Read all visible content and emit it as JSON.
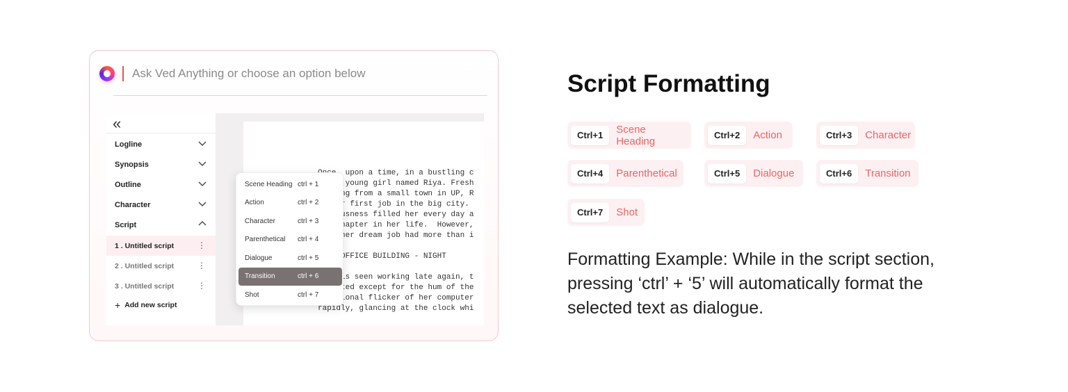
{
  "app": {
    "ask_placeholder": "Ask Ved Anything or choose an option below",
    "collapse_glyph": "«",
    "sidebar": {
      "sections": [
        {
          "label": "Logline",
          "expanded": false
        },
        {
          "label": "Synopsis",
          "expanded": false
        },
        {
          "label": "Outline",
          "expanded": false
        },
        {
          "label": "Character",
          "expanded": false
        },
        {
          "label": "Script",
          "expanded": true
        }
      ],
      "scripts": [
        {
          "label": "1 . Untitled script",
          "active": true
        },
        {
          "label": "2 . Untitled script",
          "active": false
        },
        {
          "label": "3 . Untitled script",
          "active": false
        }
      ],
      "add_script_label": "Add new script",
      "more_glyph": "⋮"
    },
    "format_menu": [
      {
        "name": "Scene Heading",
        "key": "ctrl + 1",
        "selected": false
      },
      {
        "name": "Action",
        "key": "ctrl + 2",
        "selected": false
      },
      {
        "name": "Character",
        "key": "ctrl + 3",
        "selected": false
      },
      {
        "name": "Parenthetical",
        "key": "ctrl + 4",
        "selected": false
      },
      {
        "name": "Dialogue",
        "key": "ctrl + 5",
        "selected": false
      },
      {
        "name": "Transition",
        "key": "ctrl + 6",
        "selected": true
      },
      {
        "name": "Shot",
        "key": "ctrl + 7",
        "selected": false
      }
    ],
    "script_lines": [
      "Once  upon a time, in a bustling c",
      "was a young girl named Riya. Fresh",
      "hailing from a small town in UP, R",
      "to her first job in the big city.",
      "nervousness filled her every day a",
      "new chapter in her life.  However,",
      "that her dream job had more than i",
      "",
      "INT. OFFICE BUILDING - NIGHT",
      "",
      "Riya is seen working late again, t",
      "deserted except for the hum of the",
      "occasional flicker of her computer",
      "rapidly, glancing at the clock whi"
    ]
  },
  "panel": {
    "title": "Script Formatting",
    "shortcuts": [
      {
        "key": "Ctrl+1",
        "label": "Scene Heading"
      },
      {
        "key": "Ctrl+2",
        "label": "Action"
      },
      {
        "key": "Ctrl+3",
        "label": "Character"
      },
      {
        "key": "Ctrl+4",
        "label": "Parenthetical"
      },
      {
        "key": "Ctrl+5",
        "label": "Dialogue"
      },
      {
        "key": "Ctrl+6",
        "label": "Transition"
      },
      {
        "key": "Ctrl+7",
        "label": "Shot"
      }
    ],
    "example": "Formatting Example: While in the script section, pressing ‘ctrl’ + ‘5’ will automatically format the selected text as dialogue."
  },
  "colors": {
    "accent": "#f06363",
    "chip_bg": "#fdf0f2",
    "menu_selected": "#7a7272"
  }
}
